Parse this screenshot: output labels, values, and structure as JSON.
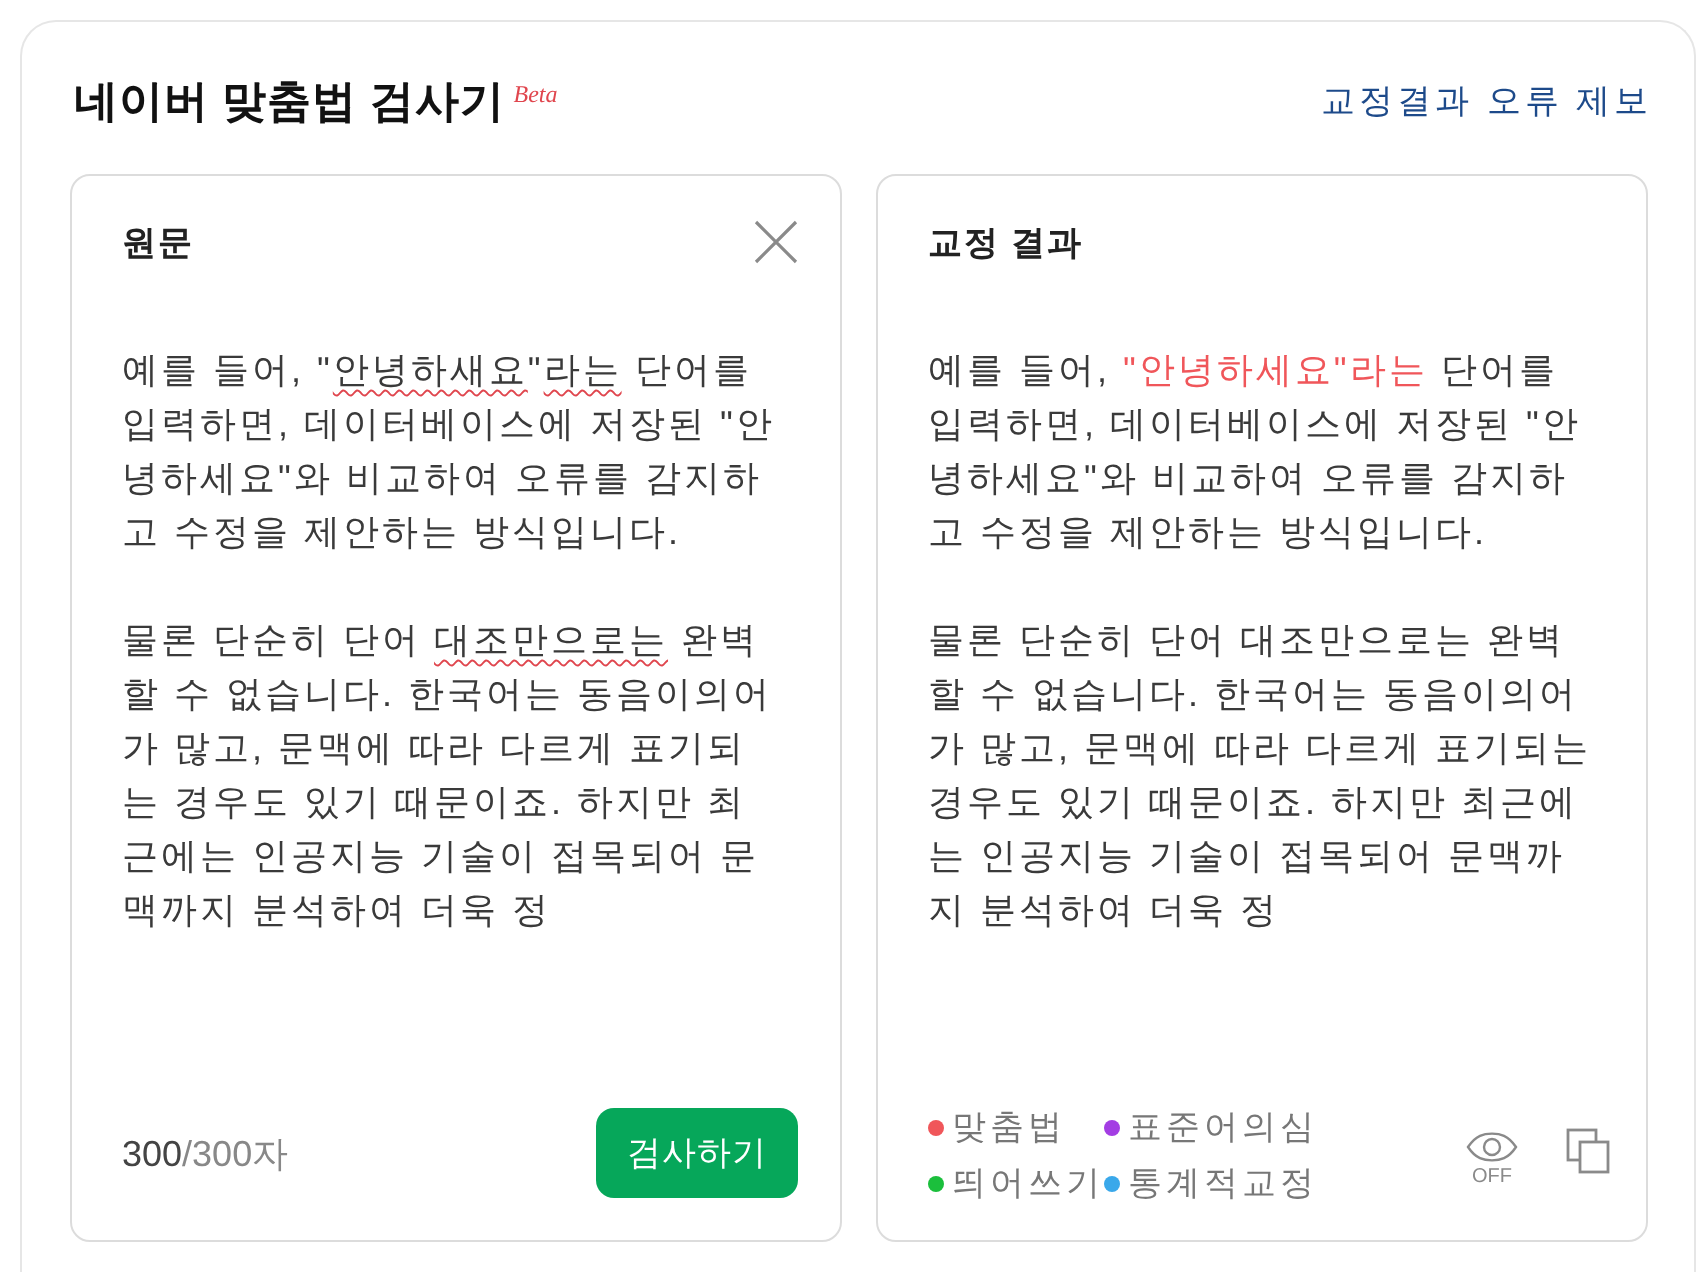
{
  "title": "네이버 맞춤법 검사기",
  "badge": "Beta",
  "report_link": "교정결과 오류 제보",
  "original": {
    "heading": "원문",
    "paragraphs": [
      [
        {
          "text": "예를 들어, \"",
          "flagged": false
        },
        {
          "text": "안녕하새요",
          "flagged": true
        },
        {
          "text": "\"",
          "flagged": false
        },
        {
          "text": "라는",
          "flagged": true
        },
        {
          "text": " 단어를 입력하면, 데이터베이스에 저장된 \"안녕하세요\"와 비교하여 오류를 감지하고 수정을 제안하는 방식입니다.",
          "flagged": false
        }
      ],
      [
        {
          "text": "물론 단순히 단어 ",
          "flagged": false
        },
        {
          "text": "대조만으로는",
          "flagged": true
        },
        {
          "text": " 완벽할 수 없습니다. 한국어는 동음이의어가 많고, 문맥에 따라 다르게 표기되는 경우도 있기 때문이죠. 하지만 최근에는 인공지능 기술이 접목되어 문맥까지 분석하여 더욱 정",
          "flagged": false
        }
      ]
    ],
    "count": "300",
    "count_limit": "/300자",
    "check_button": "검사하기"
  },
  "result": {
    "heading": "교정 결과",
    "paragraphs": [
      [
        {
          "text": "예를 들어, ",
          "kind": "plain"
        },
        {
          "text": "\"안녕하세요\"라는",
          "kind": "spelling"
        },
        {
          "text": " 단어를 입력하면, 데이터베이스에 저장된 \"안녕하세요\"와 비교하여 오류를 감지하고 수정을 제안하는 방식입니다.",
          "kind": "plain"
        }
      ],
      [
        {
          "text": "물론 단순히 단어 대조만으로는 완벽할 수 없습니다. 한국어는 동음이의어가 많고, 문맥에 따라 다르게 표기되는 경우도 있기 때문이죠. 하지만 최근에는 인공지능 기술이 접목되어 문맥까지 분석하여 더욱 정",
          "kind": "plain"
        }
      ]
    ],
    "legend": [
      {
        "label": "맞춤법",
        "kind": "spelling",
        "color": "#f0565a"
      },
      {
        "label": "표준어의심",
        "kind": "standard",
        "color": "#a33de3"
      },
      {
        "label": "띄어쓰기",
        "kind": "spacing",
        "color": "#1bbf3c"
      },
      {
        "label": "통계적교정",
        "kind": "statistical",
        "color": "#3aa8ea"
      }
    ],
    "highlight_toggle": {
      "label": "OFF",
      "on": false
    }
  }
}
